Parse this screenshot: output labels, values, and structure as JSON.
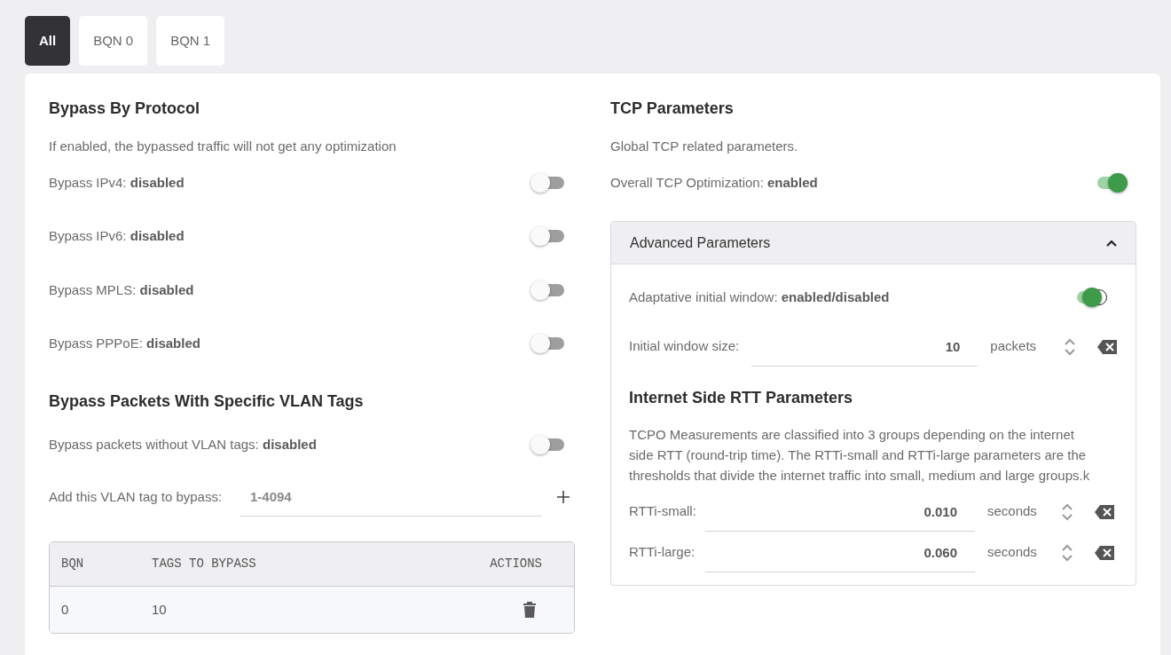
{
  "tabs": [
    {
      "label": "All",
      "selected": true
    },
    {
      "label": "BQN 0",
      "selected": false
    },
    {
      "label": "BQN 1",
      "selected": false
    }
  ],
  "protocol": {
    "title": "Bypass By Protocol",
    "description": "If enabled, the bypassed traffic will not get any optimization",
    "toggles": [
      {
        "label": "Bypass IPv4:",
        "state": "disabled",
        "on": false
      },
      {
        "label": "Bypass IPv6:",
        "state": "disabled",
        "on": false
      },
      {
        "label": "Bypass MPLS:",
        "state": "disabled",
        "on": false
      },
      {
        "label": "Bypass PPPoE:",
        "state": "disabled",
        "on": false
      }
    ]
  },
  "vlan": {
    "title": "Bypass Packets With Specific VLAN Tags",
    "toggle": {
      "label": "Bypass packets without VLAN tags:",
      "state": "disabled",
      "on": false
    },
    "add": {
      "label": "Add this VLAN tag to bypass:",
      "placeholder": "1-4094"
    },
    "table": {
      "columns": [
        "BQN",
        "TAGS TO BYPASS",
        "ACTIONS"
      ],
      "rows": [
        {
          "bqn": "0",
          "tags": "10"
        }
      ]
    }
  },
  "tcp": {
    "title": "TCP Parameters",
    "description": "Global TCP related parameters.",
    "toggle": {
      "label": "Overall TCP Optimization:",
      "state": "enabled",
      "on": true
    },
    "advanced": {
      "title": "Advanced Parameters",
      "expanded": true,
      "toggle": {
        "label": "Adaptative initial window:",
        "state": "enabled/disabled",
        "on": true
      },
      "window_size": {
        "label": "Initial window size:",
        "value": "10",
        "unit": "packets"
      },
      "rtt": {
        "title": "Internet Side RTT Parameters",
        "description": "TCPO Measurements are classified into 3 groups depending on the internet side RTT (round-trip time). The RTTi-small and RTTi-large parameters are the thresholds that divide the internet traffic into small, medium and large groups.k",
        "fields": [
          {
            "label": "RTTi-small:",
            "value": "0.010",
            "unit": "seconds"
          },
          {
            "label": "RTTi-large:",
            "value": "0.060",
            "unit": "seconds"
          }
        ]
      }
    }
  }
}
